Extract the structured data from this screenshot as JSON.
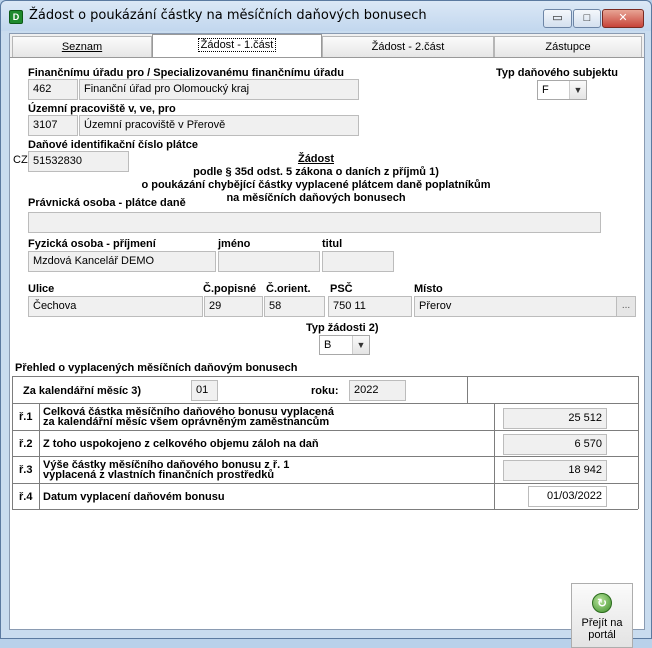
{
  "window": {
    "title": "Žádost o poukázání částky na měsíčních daňových bonusech",
    "minimize_label": "▭",
    "maximize_label": "□",
    "close_label": "✕"
  },
  "tabs": [
    {
      "label": "Seznam"
    },
    {
      "label": "Žádost - 1.část"
    },
    {
      "label": "Žádost - 2.část"
    },
    {
      "label": "Zástupce"
    }
  ],
  "form": {
    "office_label": "Finančnímu úřadu pro / Specializovanému finančnímu úřadu",
    "office_code": "462",
    "office_name": "Finanční úřad pro Olomoucký kraj",
    "subject_type_label": "Typ daňového subjektu",
    "subject_type_value": "F",
    "branch_label": "Územní pracoviště v, ve, pro",
    "branch_code": "3107",
    "branch_name": "Územní pracoviště v Přerově",
    "tin_label": "Daňové identifikační číslo plátce",
    "tin_prefix": "CZ",
    "tin_value": "51532830",
    "heading_title": "Žádost",
    "heading_line1": "podle § 35d odst. 5 zákona o daních z příjmů 1)",
    "heading_line2": "o poukázání chybějící částky vyplacené plátcem daně poplatníkům",
    "heading_line3": "na měsíčních daňových bonusech",
    "legal_entity_label": "Právnická osoba - plátce daně",
    "legal_entity_value": "",
    "surname_label": "Fyzická osoba - příjmení",
    "surname_value": "Mzdová Kancelář DEMO",
    "firstname_label": "jméno",
    "firstname_value": "",
    "titul_label": "titul",
    "titul_value": "",
    "street_label": "Ulice",
    "street_value": "Čechova",
    "cp_label": "Č.popisné",
    "cp_value": "29",
    "co_label": "Č.orient.",
    "co_value": "58",
    "psc_label": "PSČ",
    "psc_value": "750 11",
    "city_label": "Místo",
    "city_value": "Přerov",
    "city_button": "...",
    "request_type_label": "Typ žádosti 2)",
    "request_type_value": "B"
  },
  "overview": {
    "title": "Přehled o vyplacených měsíčních daňovým bonusech",
    "month_label": "Za kalendářní měsíc 3)",
    "month_value": "01",
    "year_label": "roku:",
    "year_value": "2022",
    "rows": [
      {
        "num": "ř.1",
        "text1": "Celková částka měsíčního daňového bonusu vyplacená",
        "text2": "za kalendářní měsíc všem oprávněným zaměstnancům",
        "value": "25 512"
      },
      {
        "num": "ř.2",
        "text1": "Z toho uspokojeno z celkového objemu záloh na daň",
        "text2": "",
        "value": "6 570"
      },
      {
        "num": "ř.3",
        "text1": "Výše částky měsíčního daňového bonusu z ř. 1",
        "text2": "vyplacená z vlastních finančních prostředků",
        "value": "18 942"
      },
      {
        "num": "ř.4",
        "text1": "Datum vyplacení daňovém bonusu",
        "text2": "",
        "value": "01/03/2022"
      }
    ]
  },
  "portal_button": {
    "line1": "Přejít na",
    "line2": "portál"
  }
}
